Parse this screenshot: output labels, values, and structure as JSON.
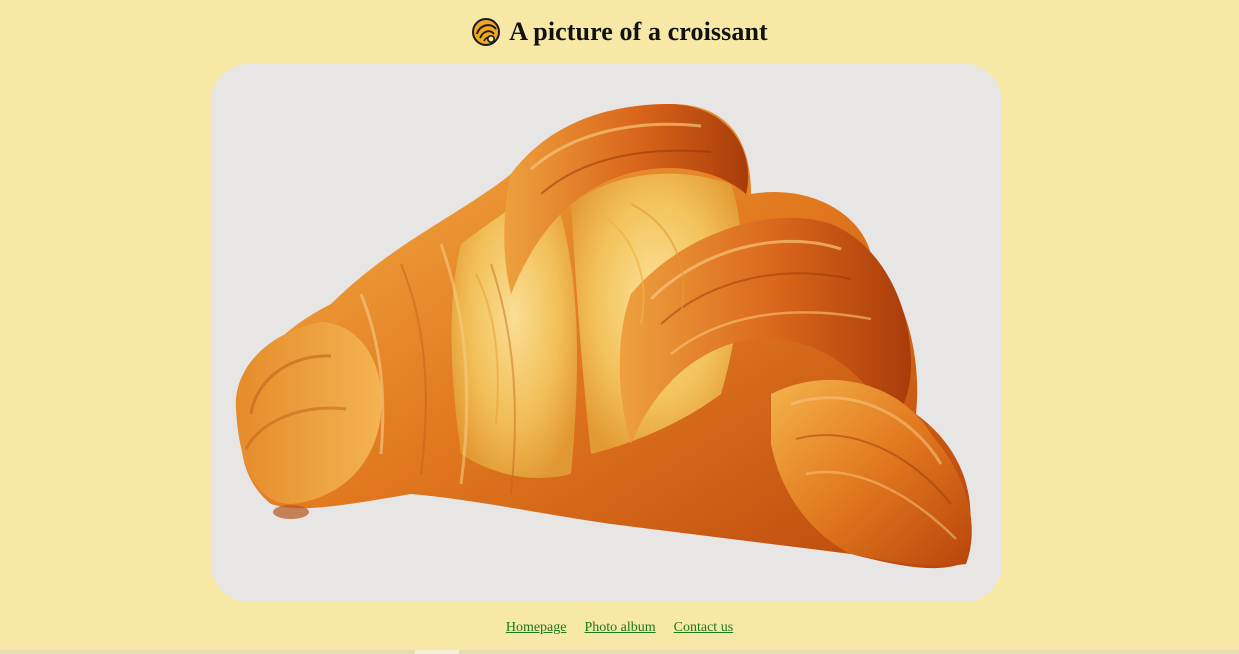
{
  "header": {
    "title": "A picture of a croissant",
    "icon": "croissant-icon"
  },
  "photo": {
    "subject": "croissant-photo",
    "background": "#e7e6e5"
  },
  "nav": {
    "items": [
      {
        "label": "Homepage"
      },
      {
        "label": "Photo album"
      },
      {
        "label": "Contact us"
      }
    ],
    "link_color": "#1a7a1a"
  },
  "colors": {
    "page_background": "#f8e8a6",
    "title_text": "#111111"
  }
}
